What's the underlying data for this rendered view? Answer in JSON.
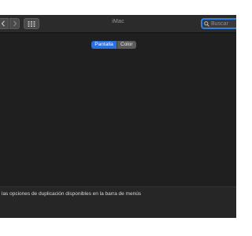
{
  "window": {
    "title": "iMac"
  },
  "toolbar": {
    "back_icon": "chevron-left-icon",
    "forward_icon": "chevron-right-icon",
    "grid_icon": "grid-icon",
    "search_icon": "search-icon",
    "search_placeholder": "Buscar"
  },
  "tabs": [
    {
      "label": "Pantalla",
      "selected": true
    },
    {
      "label": "Color",
      "selected": false
    }
  ],
  "footer": {
    "label": "las opciones de duplicación disponibles en la barra de menús"
  },
  "colors": {
    "accent": "#2a6fe0",
    "focus_ring": "#2f7fe6",
    "window_bg": "#1f1f1f"
  }
}
